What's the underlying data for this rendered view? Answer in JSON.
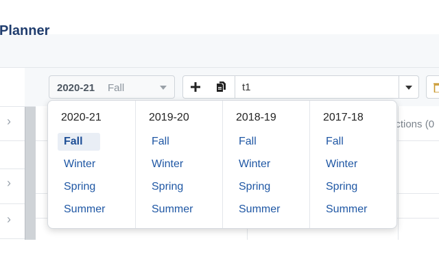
{
  "app": {
    "title": "Planner"
  },
  "term_select": {
    "year": "2020-21",
    "season": "Fall"
  },
  "plan_input": {
    "value": "t1"
  },
  "content": {
    "sections_header": "ections (0"
  },
  "dropdown": {
    "columns": [
      {
        "year": "2020-21",
        "seasons": [
          "Fall",
          "Winter",
          "Spring",
          "Summer"
        ]
      },
      {
        "year": "2019-20",
        "seasons": [
          "Fall",
          "Winter",
          "Spring",
          "Summer"
        ]
      },
      {
        "year": "2018-19",
        "seasons": [
          "Fall",
          "Winter",
          "Spring",
          "Summer"
        ]
      },
      {
        "year": "2017-18",
        "seasons": [
          "Fall",
          "Winter",
          "Spring",
          "Summer"
        ]
      }
    ],
    "selected": {
      "year": "2020-21",
      "season": "Fall"
    }
  },
  "icons": {
    "add": "plus-icon",
    "copy": "copy-icon",
    "caret": "chevron-down-icon",
    "trash": "trash-icon",
    "row_arrow": "chevron-right-icon"
  },
  "colors": {
    "link": "#1f57a4",
    "title": "#1f3c6d",
    "selected_bg": "#e9eef5"
  }
}
